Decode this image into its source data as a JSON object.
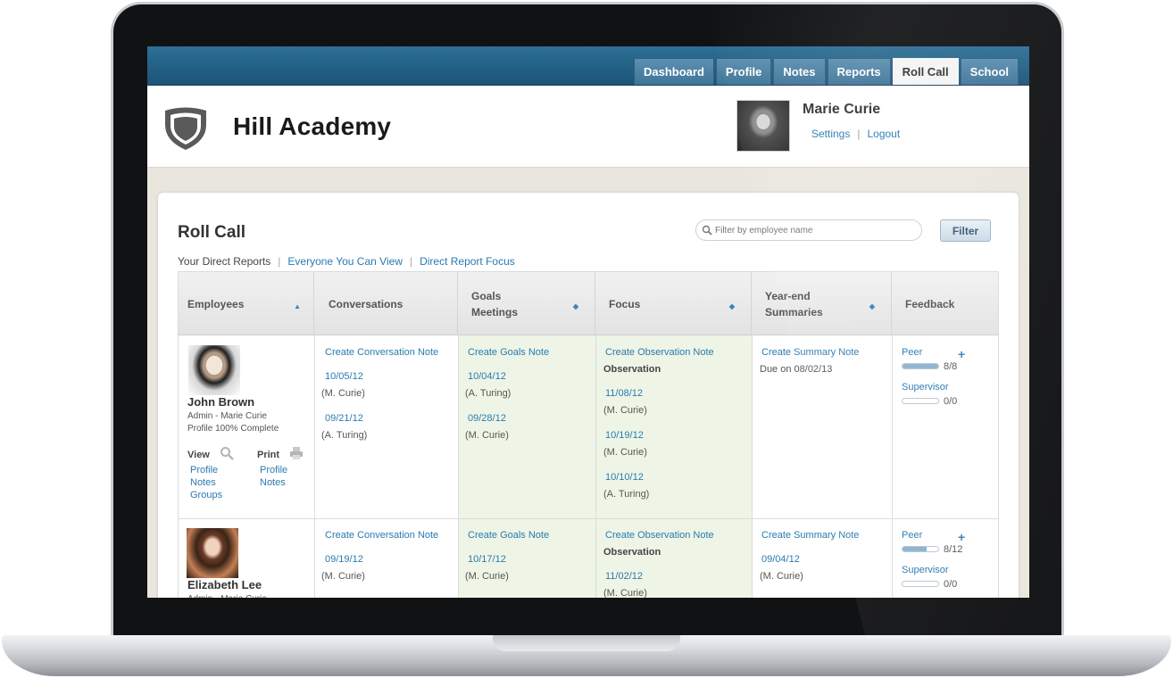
{
  "nav": {
    "tabs": [
      {
        "label": "Dashboard",
        "active": false
      },
      {
        "label": "Profile",
        "active": false
      },
      {
        "label": "Notes",
        "active": false
      },
      {
        "label": "Reports",
        "active": false
      },
      {
        "label": "Roll Call",
        "active": true
      },
      {
        "label": "School",
        "active": false
      }
    ]
  },
  "header": {
    "school_name": "Hill Academy",
    "user_name": "Marie Curie",
    "settings_label": "Settings",
    "separator": "|",
    "logout_label": "Logout"
  },
  "page": {
    "title": "Roll Call",
    "search_placeholder": "Filter by employee name",
    "filter_label": "Filter",
    "view_tabs": [
      "Your Direct Reports",
      "Everyone You Can View",
      "Direct Report Focus"
    ]
  },
  "table": {
    "columns": [
      "Employees",
      "Conversations",
      "Goals Meetings",
      "Focus",
      "Year-end Summaries",
      "Feedback"
    ],
    "rows": [
      {
        "employee": {
          "name": "John Brown",
          "role": "Admin - Marie Curie",
          "profile_status": "Profile 100% Complete",
          "view_label": "View",
          "print_label": "Print",
          "view_links": [
            "Profile",
            "Notes",
            "Groups"
          ],
          "print_links": [
            "Profile",
            "Notes"
          ]
        },
        "conversations": {
          "create_label": "Create Conversation Note",
          "entries": [
            {
              "date": "10/05/12",
              "author": "(M. Curie)"
            },
            {
              "date": "09/21/12",
              "author": "(A. Turing)"
            }
          ]
        },
        "goals": {
          "create_label": "Create Goals Note",
          "entries": [
            {
              "date": "10/04/12",
              "author": "(A. Turing)"
            },
            {
              "date": "09/28/12",
              "author": "(M. Curie)"
            }
          ]
        },
        "focus": {
          "create_label": "Create Observation Note",
          "type_label": "Observation",
          "entries": [
            {
              "date": "11/08/12",
              "author": "(M. Curie)"
            },
            {
              "date": "10/19/12",
              "author": "(M. Curie)"
            },
            {
              "date": "10/10/12",
              "author": "(A. Turing)"
            }
          ]
        },
        "summaries": {
          "create_label": "Create Summary Note",
          "due": "Due on 08/02/13"
        },
        "feedback": {
          "peer_label": "Peer",
          "peer_count": "8/8",
          "peer_done": 8,
          "peer_total": 8,
          "supervisor_label": "Supervisor",
          "supervisor_count": "0/0",
          "supervisor_done": 0,
          "supervisor_total": 0
        }
      },
      {
        "employee": {
          "name": "Elizabeth Lee",
          "role": "Admin - Marie Curie"
        },
        "conversations": {
          "create_label": "Create Conversation Note",
          "entries": [
            {
              "date": "09/19/12",
              "author": "(M. Curie)"
            }
          ]
        },
        "goals": {
          "create_label": "Create Goals Note",
          "entries": [
            {
              "date": "10/17/12",
              "author": "(M. Curie)"
            }
          ]
        },
        "focus": {
          "create_label": "Create Observation Note",
          "type_label": "Observation",
          "entries": [
            {
              "date": "11/02/12",
              "author": "(M. Curie)"
            }
          ]
        },
        "summaries": {
          "create_label": "Create Summary Note",
          "entries": [
            {
              "date": "09/04/12",
              "author": "(M. Curie)"
            }
          ]
        },
        "feedback": {
          "peer_label": "Peer",
          "peer_count": "8/12",
          "peer_done": 8,
          "peer_total": 12,
          "supervisor_label": "Supervisor",
          "supervisor_count": "0/0",
          "supervisor_done": 0,
          "supervisor_total": 0
        }
      }
    ]
  },
  "colors": {
    "nav_bar": "#1d5477",
    "link": "#2a7ab0",
    "highlight_column": "#eef5e6",
    "progress_fill": "#8cb3d0"
  },
  "icons": [
    "shield-logo-icon",
    "search-icon",
    "magnifier-icon",
    "printer-icon",
    "plus-icon",
    "sort-arrow-icon"
  ]
}
